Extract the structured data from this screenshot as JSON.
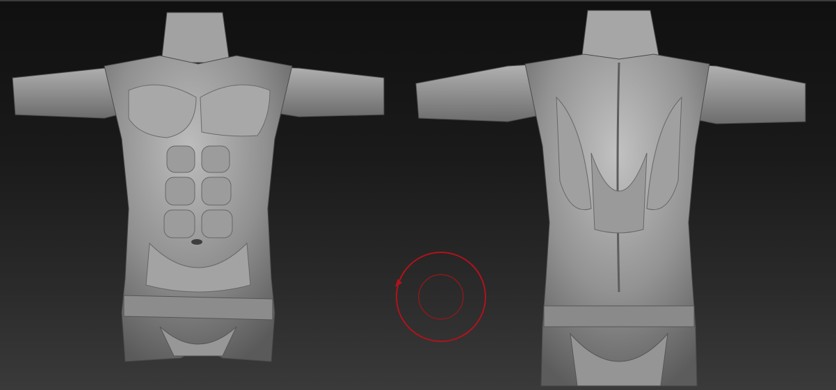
{
  "viewport": {
    "background_top": "#101010",
    "background_bottom": "#3a3a3a"
  },
  "models": [
    {
      "name": "torso-front-view",
      "view": "front",
      "color": "#9a9a9a"
    },
    {
      "name": "torso-back-view",
      "view": "back",
      "color": "#9a9a9a"
    }
  ],
  "brush_cursor": {
    "icon": "brush-cursor-icon",
    "color": "#b3121b"
  }
}
